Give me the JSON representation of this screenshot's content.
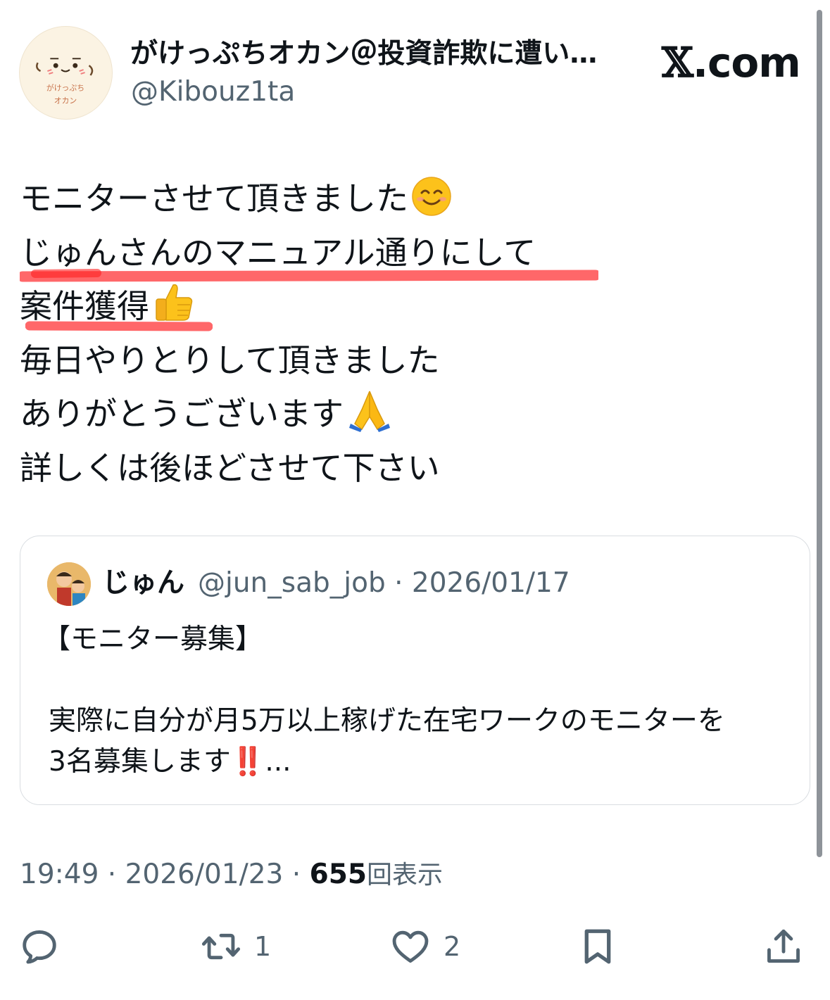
{
  "author": {
    "display_name": "がけっぷちオカン＠投資詐欺に遭い…",
    "handle": "@Kibouz1ta",
    "avatar_text_1": "がけっぷち",
    "avatar_text_2": "オカン"
  },
  "brand": {
    "x_mark": "𝕏",
    "domain": ".com"
  },
  "tweet": {
    "lines": [
      "モニターさせて頂きました",
      "じゅんさんのマニュアル通りにして",
      "案件獲得",
      "毎日やりとりして頂きました",
      "ありがとうございます",
      "詳しくは後ほどさせて下さい"
    ],
    "emojis": {
      "line1": "smiling-face-emoji",
      "line3": "thumbs-up-emoji",
      "line5": "folded-hands-emoji"
    },
    "underline_color": "#ff4d4f"
  },
  "quote": {
    "name": "じゅん",
    "meta": "@jun_sab_job · 2026/01/17",
    "title": "【モニター募集】",
    "text_line1": "実際に自分が月5万以上稼げた在宅ワークのモニターを",
    "text_line2": "3名募集します",
    "bang": "‼️",
    "ellipsis": "..."
  },
  "meta": {
    "time_date": "19:49 · 2026/01/23 · ",
    "views": "655",
    "views_label": "回表示"
  },
  "actions": {
    "retweet_count": "1",
    "like_count": "2"
  },
  "colors": {
    "text": "#0f1419",
    "secondary": "#536471",
    "border": "#d9dde1"
  }
}
